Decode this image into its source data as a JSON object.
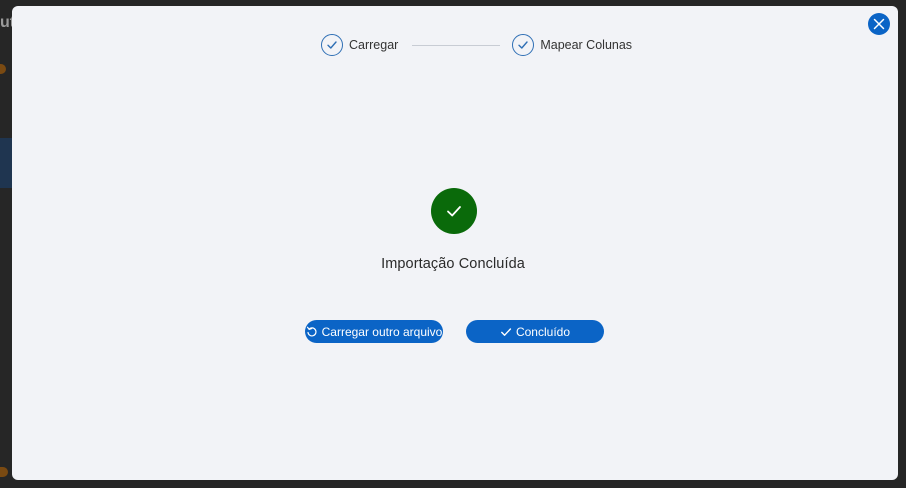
{
  "backdrop": {
    "partial_text": "ut"
  },
  "modal": {
    "close_icon": "close-icon",
    "steps": [
      {
        "label": "Carregar",
        "status": "complete",
        "icon": "check-icon"
      },
      {
        "label": "Mapear Colunas",
        "status": "complete",
        "icon": "check-icon"
      }
    ],
    "result": {
      "icon": "check-circle-icon",
      "title": "Importação Concluída"
    },
    "actions": {
      "reload_label": "Carregar outro arquivo",
      "reload_icon": "refresh-icon",
      "done_label": "Concluído",
      "done_icon": "check-icon"
    }
  },
  "colors": {
    "accent": "#0b64c6",
    "success": "#0a6a0a",
    "modal_bg": "#f2f3f7",
    "step_border": "#2f6fb5"
  }
}
